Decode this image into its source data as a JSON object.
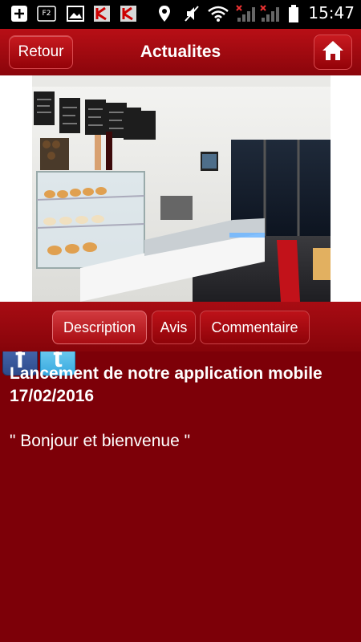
{
  "status_bar": {
    "time": "15:47",
    "icons": [
      "add-notification-icon",
      "f2-icon",
      "image-icon",
      "app-icon",
      "app-icon",
      "location-icon",
      "mute-icon",
      "wifi-icon",
      "signal-icon",
      "signal-icon",
      "battery-icon"
    ],
    "f2_label": "F2"
  },
  "header": {
    "back_label": "Retour",
    "title": "Actualites",
    "home_icon": "home-icon"
  },
  "photo": {
    "description": "bakery-counter-photo"
  },
  "social": {
    "facebook_glyph": "f",
    "twitter_glyph": "t"
  },
  "tabs": [
    {
      "label": "Description",
      "active": true
    },
    {
      "label": "Avis",
      "active": false
    },
    {
      "label": "Commentaire",
      "active": false
    }
  ],
  "article": {
    "title": "Lancement de notre application mobile 17/02/2016",
    "body": "\" Bonjour et bienvenue \""
  },
  "colors": {
    "background": "#7d0008",
    "header": "#b80f16",
    "button": "#c81a20"
  }
}
